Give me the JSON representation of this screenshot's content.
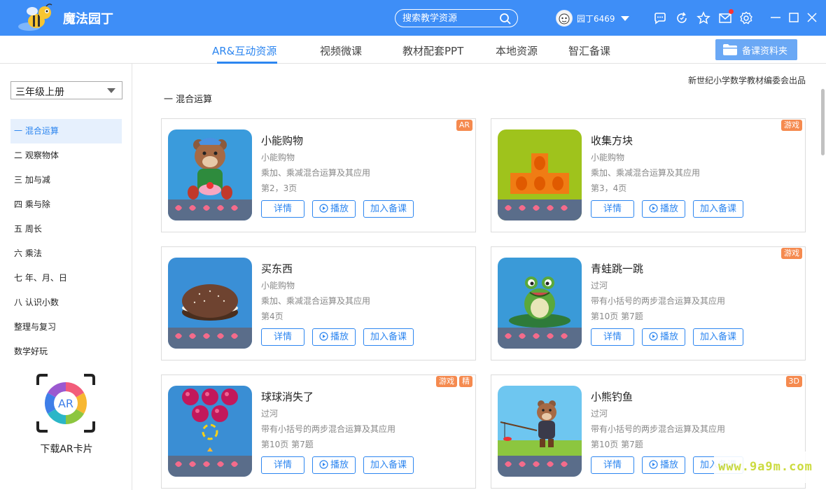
{
  "app": {
    "title": "魔法园丁"
  },
  "search": {
    "placeholder": "搜索教学资源"
  },
  "user": {
    "name": "园丁6469"
  },
  "tabs": [
    {
      "label": "AR&互动资源",
      "active": true
    },
    {
      "label": "视频微课",
      "active": false
    },
    {
      "label": "教材配套PPT",
      "active": false
    },
    {
      "label": "本地资源",
      "active": false
    },
    {
      "label": "智汇备课",
      "active": false
    }
  ],
  "folder_button": {
    "label": "备课资料夹"
  },
  "sidebar": {
    "grade": "三年级上册",
    "chapters": [
      {
        "label": "一 混合运算",
        "active": true
      },
      {
        "label": "二 观察物体",
        "active": false
      },
      {
        "label": "三 加与减",
        "active": false
      },
      {
        "label": "四 乘与除",
        "active": false
      },
      {
        "label": "五 周长",
        "active": false
      },
      {
        "label": "六 乘法",
        "active": false
      },
      {
        "label": "七 年、月、日",
        "active": false
      },
      {
        "label": "八 认识小数",
        "active": false
      },
      {
        "label": "整理与复习",
        "active": false
      },
      {
        "label": "数学好玩",
        "active": false
      }
    ],
    "ar_card_label": "下载AR卡片",
    "ar_card_logo_text": "AR"
  },
  "main": {
    "publisher": "新世纪小学数学教材编委会出品",
    "section_title": "一 混合运算"
  },
  "buttons": {
    "detail": "详情",
    "play": "播放",
    "add": "加入备课"
  },
  "resources": [
    {
      "title": "小能购物",
      "subtitle": "小能购物",
      "desc": "乘加、乘减混合运算及其应用",
      "pages": "第2，3页",
      "tags": [
        "AR"
      ],
      "thumb": "bear-shopping"
    },
    {
      "title": "收集方块",
      "subtitle": "小能购物",
      "desc": "乘加、乘减混合运算及其应用",
      "pages": "第3，4页",
      "tags": [
        "游戏"
      ],
      "thumb": "orange-blocks"
    },
    {
      "title": "买东西",
      "subtitle": "小能购物",
      "desc": "乘加、乘减混合运算及其应用",
      "pages": "第4页",
      "tags": [],
      "thumb": "cookie"
    },
    {
      "title": "青蛙跳一跳",
      "subtitle": "过河",
      "desc": "带有小括号的两步混合运算及其应用",
      "pages": "第10页  第7题",
      "tags": [
        "游戏"
      ],
      "thumb": "frog"
    },
    {
      "title": "球球消失了",
      "subtitle": "过河",
      "desc": "带有小括号的两步混合运算及其应用",
      "pages": "第10页  第7题",
      "tags": [
        "游戏",
        "精"
      ],
      "thumb": "bubbles"
    },
    {
      "title": "小熊钓鱼",
      "subtitle": "过河",
      "desc": "带有小括号的两步混合运算及其应用",
      "pages": "第10页  第7题",
      "tags": [
        "3D"
      ],
      "thumb": "bear-fishing"
    }
  ],
  "watermark": "www.9a9m.com"
}
